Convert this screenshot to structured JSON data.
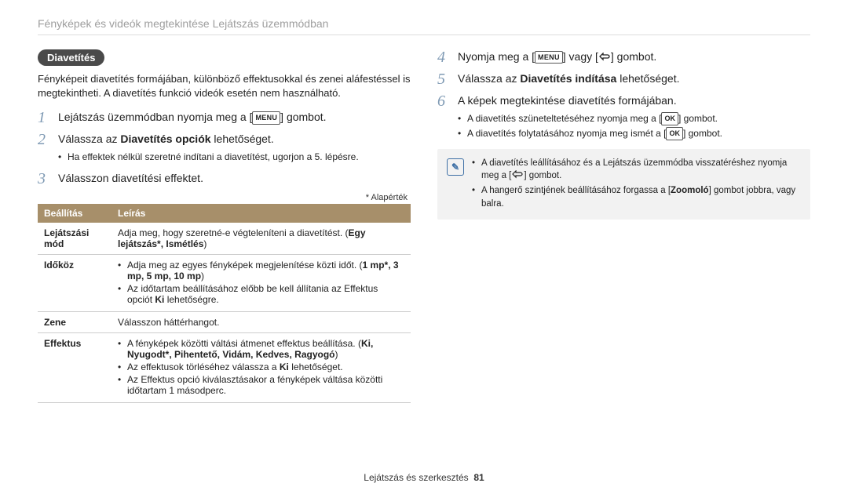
{
  "header": {
    "title": "Fényképek és videók megtekintése Lejátszás üzemmódban"
  },
  "section": {
    "badge": "Diavetítés",
    "intro": "Fényképeit diavetítés formájában, különböző effektusokkal és zenei aláfestéssel is megtekintheti. A diavetítés funkció videók esetén nem használható."
  },
  "steps": {
    "s1_pre": "Lejátszás üzemmódban nyomja meg a [",
    "s1_post": "] gombot.",
    "s2_pre": "Válassza az ",
    "s2_bold": "Diavetítés opciók",
    "s2_post": " lehetőséget.",
    "s2_sub1": "Ha effektek nélkül szeretné indítani a diavetítést, ugorjon a 5. lépésre.",
    "s3": "Válasszon diavetítési effektet.",
    "s4_pre": "Nyomja meg a [",
    "s4_mid": "] vagy [",
    "s4_post": "] gombot.",
    "s5_pre": "Válassza az ",
    "s5_bold": "Diavetítés indítása",
    "s5_post": " lehetőséget.",
    "s6": "A képek megtekintése diavetítés formájában.",
    "s6_sub1_pre": "A diavetítés szüneteltetéséhez nyomja meg a [",
    "s6_sub1_post": "] gombot.",
    "s6_sub2_pre": "A diavetítés folytatásához nyomja meg ismét a [",
    "s6_sub2_post": "] gombot."
  },
  "glyphs": {
    "menu": "MENU",
    "ok": "OK"
  },
  "default_note": "* Alapérték",
  "table": {
    "headers": {
      "a": "Beállítás",
      "b": "Leírás"
    },
    "rows": [
      {
        "key": "Lejátszási mód",
        "desc_line": "Adja meg, hogy szeretné-e végteleníteni a diavetítést.",
        "desc_bold": "Egy lejátszás*, Ismétlés"
      },
      {
        "key": "Időköz",
        "li1": "Adja meg az egyes fényképek megjelenítése közti időt.",
        "li1_bold": "1 mp*, 3 mp, 5 mp, 10 mp",
        "li2_pre": "Az időtartam beállításához előbb be kell állítania az Effektus opciót ",
        "li2_bold": "Ki",
        "li2_post": " lehetőségre."
      },
      {
        "key": "Zene",
        "line": "Válasszon háttérhangot."
      },
      {
        "key": "Effektus",
        "li1": "A fényképek közötti váltási átmenet effektus beállítása.",
        "li1_bold": "Ki, Nyugodt*, Pihentető, Vidám, Kedves, Ragyogó",
        "li2_pre": "Az effektusok törléséhez válassza a ",
        "li2_bold": "Ki",
        "li2_post": " lehetőséget.",
        "li3": "Az Effektus opció kiválasztásakor a fényképek váltása közötti időtartam 1 másodperc."
      }
    ]
  },
  "note": {
    "li1_pre": "A diavetítés leállításához és a Lejátszás üzemmódba visszatéréshez nyomja meg a [",
    "li1_post": "] gombot.",
    "li2_pre": "A hangerő szintjének beállításához forgassa a [",
    "li2_bold": "Zoomoló",
    "li2_post": "] gombot jobbra, vagy balra."
  },
  "footer": {
    "text": "Lejátszás és szerkesztés",
    "page": "81"
  }
}
